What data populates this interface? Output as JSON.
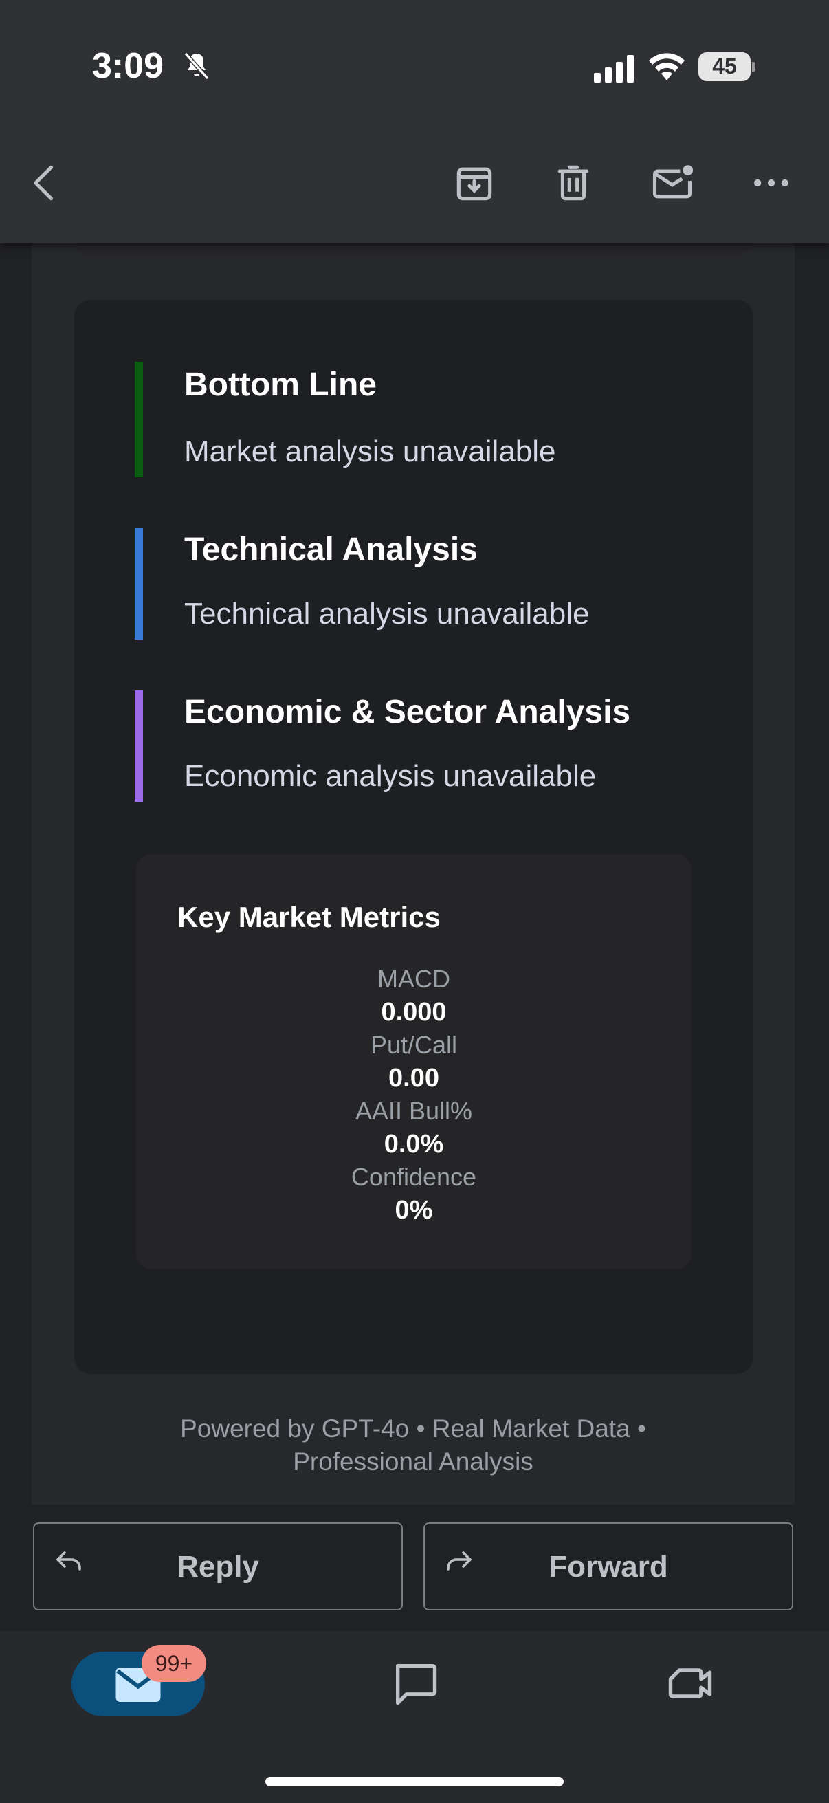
{
  "status_bar": {
    "time": "3:09",
    "battery": "45"
  },
  "sections": [
    {
      "title": "Bottom Line",
      "body": "Market analysis unavailable",
      "color": "#0a5c10"
    },
    {
      "title": "Technical Analysis",
      "body": "Technical analysis unavailable",
      "color": "#3b7bd8"
    },
    {
      "title": "Economic & Sector Analysis",
      "body": "Economic analysis unavailable",
      "color": "#9b6bea"
    }
  ],
  "metrics": {
    "title": "Key Market Metrics",
    "items": [
      {
        "label": "MACD",
        "value": "0.000"
      },
      {
        "label": "Put/Call",
        "value": "0.00"
      },
      {
        "label": "AAII Bull%",
        "value": "0.0%"
      },
      {
        "label": "Confidence",
        "value": "0%"
      }
    ]
  },
  "footer": {
    "line1": "Powered by GPT-4o • Real Market Data •",
    "line2": "Professional Analysis"
  },
  "actions": {
    "reply": "Reply",
    "forward": "Forward"
  },
  "nav": {
    "mail_badge": "99+"
  }
}
